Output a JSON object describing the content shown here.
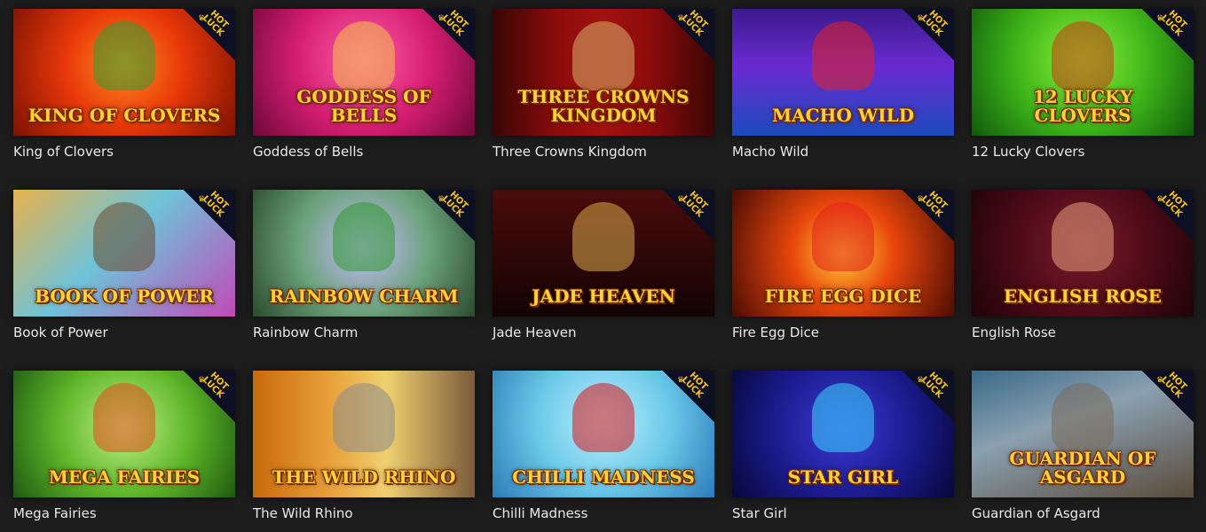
{
  "games": [
    {
      "name": "King of Clovers",
      "art_title": "King of Clovers",
      "hot": true,
      "bg": "radial-gradient(circle at 50% 45%,#ff8a1e 0%,#e8380a 45%,#7d1202 100%)",
      "accent": "#2f9e2f"
    },
    {
      "name": "Goddess of Bells",
      "art_title": "Goddess of Bells",
      "hot": true,
      "bg": "radial-gradient(circle at 50% 40%,#ff5fa8 0%,#d61e73 50%,#6e0737 100%)",
      "accent": "#f4c24a"
    },
    {
      "name": "Three Crowns Kingdom",
      "art_title": "Three Crowns Kingdom",
      "hot": true,
      "bg": "linear-gradient(90deg,#3a0505 0%,#8e0c0c 30%,#a1120f 50%,#8e0c0c 70%,#3a0505 100%)",
      "accent": "#d8b06a"
    },
    {
      "name": "Macho Wild",
      "art_title": "Macho Wild",
      "hot": true,
      "bg": "linear-gradient(180deg,#3a1a8c 0%,#6a2ad1 45%,#1c4bbd 100%)",
      "accent": "#e32020"
    },
    {
      "name": "12 Lucky Clovers",
      "art_title": "12 Lucky Clovers",
      "hot": true,
      "bg": "radial-gradient(circle at 50% 40%,#8ef03a 0%,#3eb51a 50%,#0f5a0a 100%)",
      "accent": "#c93a12"
    },
    {
      "name": "Book of Power",
      "art_title": "Book of Power",
      "hot": true,
      "bg": "linear-gradient(135deg,#e8b24a 0%,#6ec3d9 45%,#c14ab8 100%)",
      "accent": "#6b4a2a"
    },
    {
      "name": "Rainbow Charm",
      "art_title": "Rainbow Charm",
      "hot": true,
      "bg": "radial-gradient(circle at 50% 45%,#c9b8ff 0%,#6aa27a 50%,#2c4a2e 100%)",
      "accent": "#2e9a2e"
    },
    {
      "name": "Jade Heaven",
      "art_title": "Jade Heaven",
      "hot": true,
      "bg": "linear-gradient(180deg,#4a0c0c 0%,#2a0606 60%,#130303 100%)",
      "accent": "#d8a94a"
    },
    {
      "name": "Fire Egg Dice",
      "art_title": "Fire Egg Dice",
      "hot": true,
      "bg": "radial-gradient(circle at 50% 50%,#ffcf3a 0%,#e8460c 40%,#4a0c04 100%)",
      "accent": "#e2211b"
    },
    {
      "name": "English Rose",
      "art_title": "English Rose",
      "hot": true,
      "bg": "radial-gradient(circle at 50% 45%,#7a1a2a 0%,#4a0a16 55%,#1e0308 100%)",
      "accent": "#e8a080"
    },
    {
      "name": "Mega Fairies",
      "art_title": "Mega Fairies",
      "hot": true,
      "bg": "radial-gradient(circle at 50% 45%,#c3f08a 0%,#5fb72a 50%,#1e5a10 100%)",
      "accent": "#e34a1a"
    },
    {
      "name": "The Wild Rhino",
      "art_title": "The Wild Rhino",
      "hot": false,
      "bg": "linear-gradient(90deg,#c86a0c 0%,#e8a03a 35%,#f0d070 60%,#7a5a3a 100%)",
      "accent": "#8a8a8a"
    },
    {
      "name": "Chilli Madness",
      "art_title": "Chilli Madness",
      "hot": true,
      "bg": "radial-gradient(circle at 50% 40%,#bdf0ff 0%,#6ac8e8 50%,#2a7ab8 100%)",
      "accent": "#d8181a"
    },
    {
      "name": "Star Girl",
      "art_title": "Star Girl",
      "hot": true,
      "bg": "radial-gradient(circle at 50% 45%,#3a3ad8 0%,#1a1a8a 55%,#07073a 100%)",
      "accent": "#3ad8ff"
    },
    {
      "name": "Guardian of Asgard",
      "art_title": "Guardian of Asgard",
      "hot": true,
      "bg": "linear-gradient(160deg,#3a6a8a 0%,#8aa0b0 40%,#5a4a3a 100%)",
      "accent": "#7a6a5a"
    }
  ],
  "hot_badge": {
    "line1": "HOT",
    "line2": "LUCK",
    "icon": "crown-icon"
  },
  "colors": {
    "page_bg": "#1d1d1d",
    "label": "#e9e9e9",
    "badge_bg": "#0d0f22",
    "badge_text": "#f7c417"
  }
}
